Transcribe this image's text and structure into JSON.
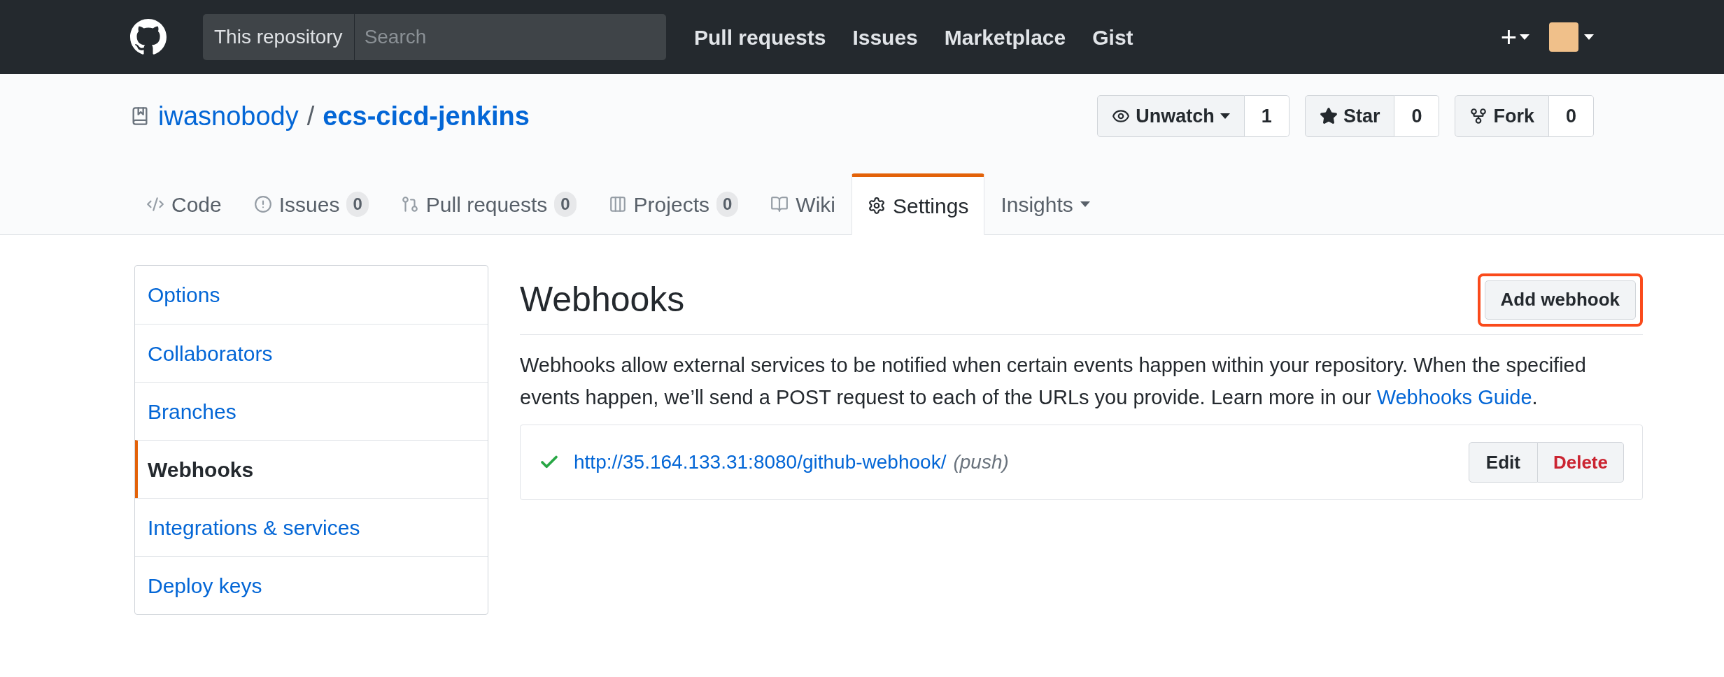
{
  "header": {
    "scope": "This repository",
    "search": {
      "placeholder": "Search"
    },
    "nav": [
      "Pull requests",
      "Issues",
      "Marketplace",
      "Gist"
    ],
    "new_menu": "+"
  },
  "repo": {
    "owner": "iwasnobody",
    "separator": "/",
    "name": "ecs-cicd-jenkins",
    "actions": [
      {
        "kind": "watch",
        "label": "Unwatch",
        "count": "1"
      },
      {
        "kind": "star",
        "label": "Star",
        "count": "0"
      },
      {
        "kind": "fork",
        "label": "Fork",
        "count": "0"
      }
    ]
  },
  "tabs": [
    {
      "kind": "code",
      "label": "Code",
      "selected": false
    },
    {
      "kind": "issues",
      "label": "Issues",
      "count": "0",
      "selected": false
    },
    {
      "kind": "pulls",
      "label": "Pull requests",
      "count": "0",
      "selected": false
    },
    {
      "kind": "projects",
      "label": "Projects",
      "count": "0",
      "selected": false
    },
    {
      "kind": "wiki",
      "label": "Wiki",
      "selected": false
    },
    {
      "kind": "settings",
      "label": "Settings",
      "selected": true
    },
    {
      "kind": "insights",
      "label": "Insights",
      "dropdown": true,
      "selected": false
    }
  ],
  "sidebar": {
    "items": [
      {
        "label": "Options",
        "selected": false
      },
      {
        "label": "Collaborators",
        "selected": false
      },
      {
        "label": "Branches",
        "selected": false
      },
      {
        "label": "Webhooks",
        "selected": true
      },
      {
        "label": "Integrations & services",
        "selected": false
      },
      {
        "label": "Deploy keys",
        "selected": false
      }
    ]
  },
  "main": {
    "title": "Webhooks",
    "add_button": {
      "label": "Add webhook",
      "highlighted": true
    },
    "description": "Webhooks allow external services to be notified when certain events happen within your repository. When the specified events happen, we’ll send a POST request to each of the URLs you provide. Learn more in our ",
    "guide_link": "Webhooks Guide",
    "description_end": ".",
    "hooks": [
      {
        "passing": true,
        "url": "http://35.164.133.31:8080/github-webhook/",
        "events": "(push)",
        "edit": "Edit",
        "delete": "Delete"
      }
    ]
  }
}
